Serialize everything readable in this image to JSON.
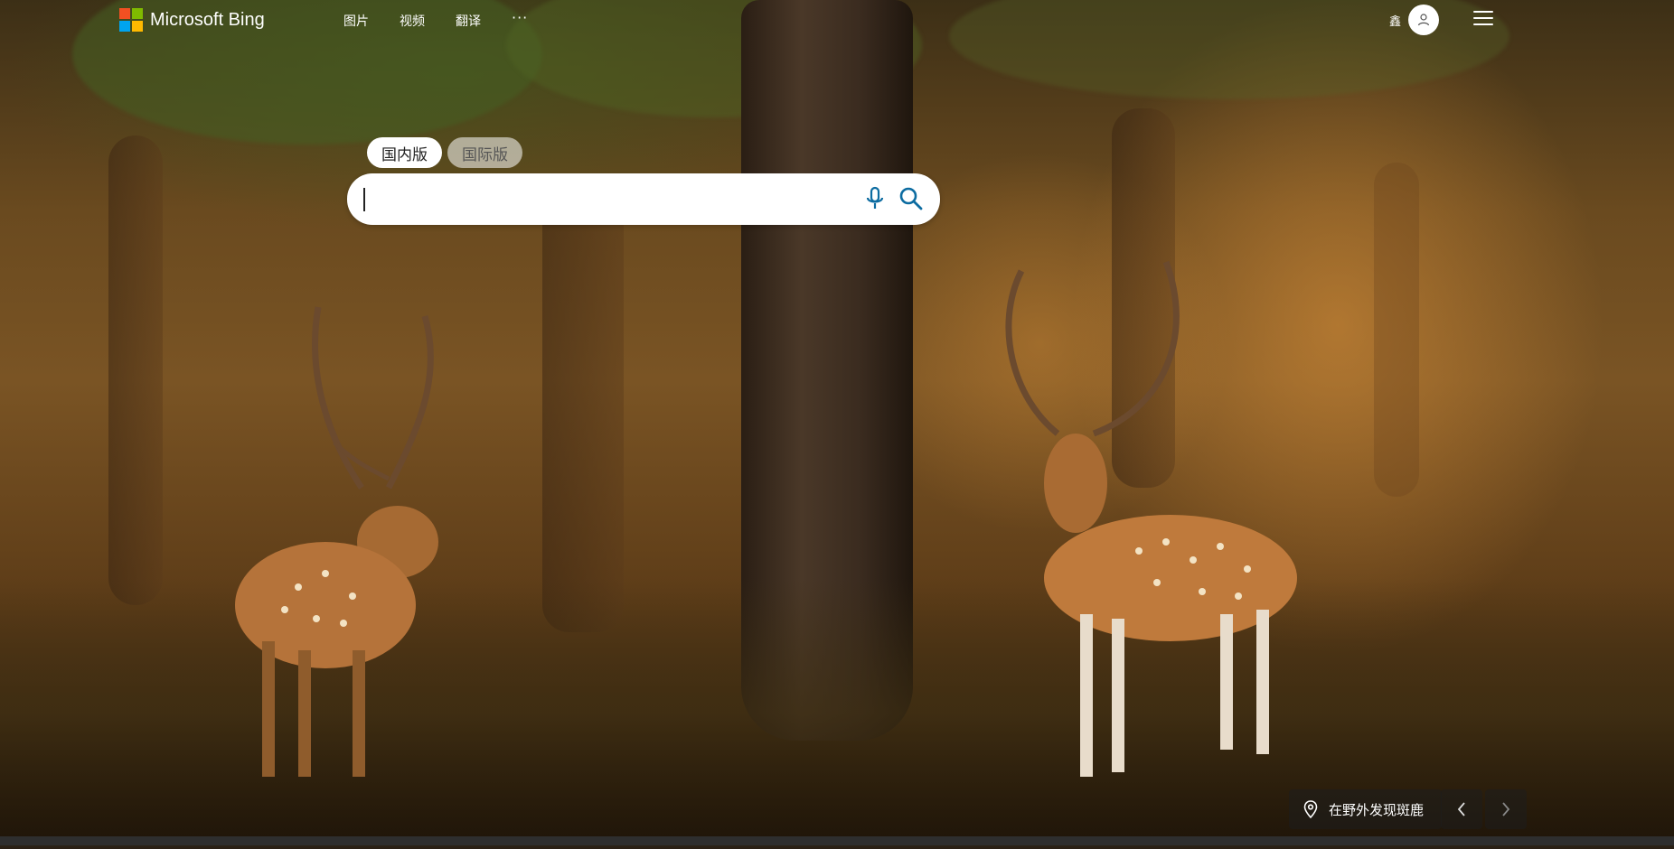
{
  "header": {
    "logo_text": "Microsoft Bing",
    "nav": [
      {
        "label": "图片"
      },
      {
        "label": "视频"
      },
      {
        "label": "翻译"
      }
    ],
    "more_label": "···",
    "rewards_label": "鑫"
  },
  "search": {
    "tabs": [
      {
        "label": "国内版",
        "active": true
      },
      {
        "label": "国际版",
        "active": false
      }
    ],
    "value": "",
    "placeholder": ""
  },
  "image_caption": {
    "text": "在野外发现斑鹿"
  },
  "colors": {
    "ms_red": "#F25022",
    "ms_green": "#7FBA00",
    "ms_blue": "#00A4EF",
    "ms_yellow": "#FFB900",
    "search_icon": "#0D6CA1"
  },
  "icons": {
    "mic": "microphone-icon",
    "search": "search-icon",
    "location": "location-pin-icon",
    "prev": "chevron-left-icon",
    "next": "chevron-right-icon",
    "menu": "hamburger-menu-icon",
    "avatar": "user-avatar-icon"
  }
}
